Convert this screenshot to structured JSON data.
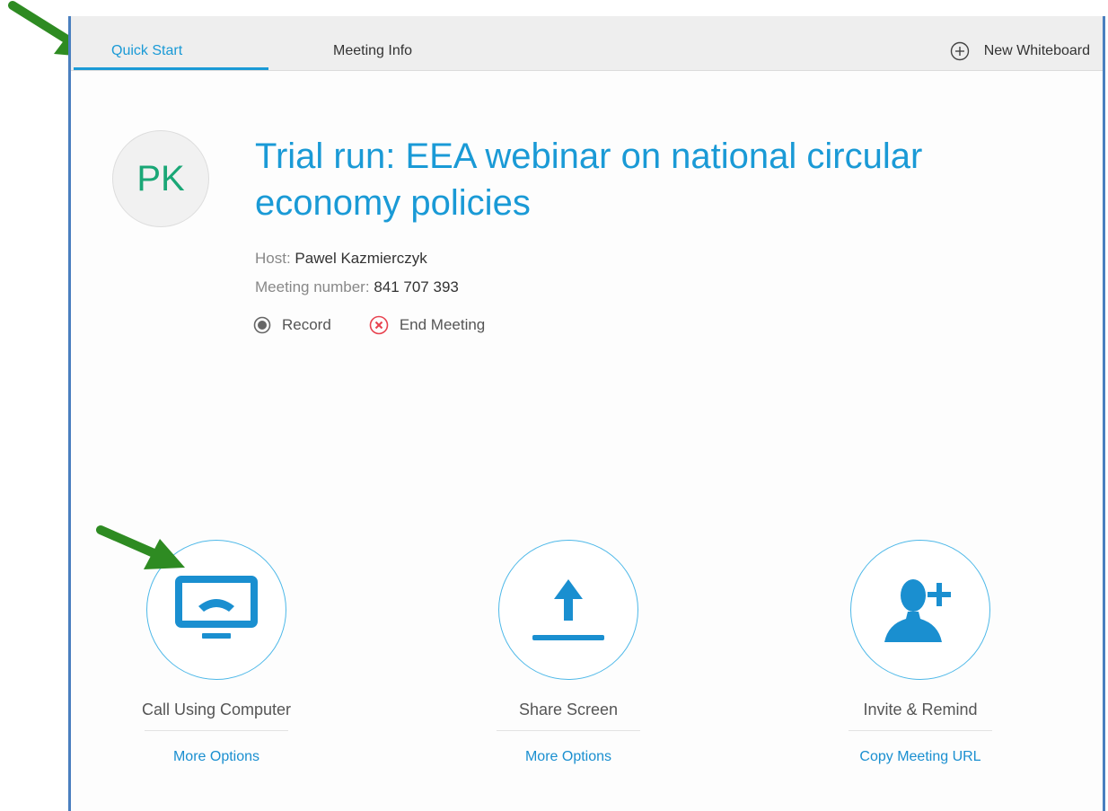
{
  "tabs": {
    "quick_start": "Quick Start",
    "meeting_info": "Meeting Info",
    "new_whiteboard": "New Whiteboard"
  },
  "meeting": {
    "avatar_initials": "PK",
    "title": "Trial run: EEA webinar on national circular economy policies",
    "host_label": "Host:",
    "host_name": "Pawel Kazmierczyk",
    "number_label": "Meeting number:",
    "number": "841 707 393",
    "record_label": "Record",
    "end_label": "End Meeting"
  },
  "cards": [
    {
      "label": "Call Using Computer",
      "link": "More Options",
      "icon": "computer-phone-icon"
    },
    {
      "label": "Share Screen",
      "link": "More Options",
      "icon": "share-upload-icon"
    },
    {
      "label": "Invite & Remind",
      "link": "Copy Meeting URL",
      "icon": "add-person-icon"
    }
  ],
  "colors": {
    "accent": "#1a9ad6",
    "avatar_text": "#1aa776",
    "end_meeting": "#e8424f",
    "annotation_arrow": "#2e8b22"
  }
}
